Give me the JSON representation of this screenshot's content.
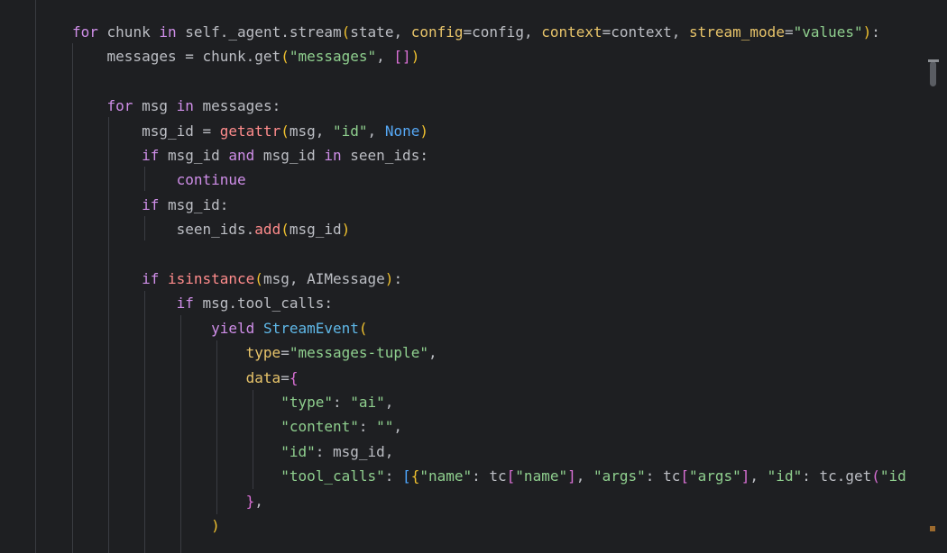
{
  "code_lines": [
    {
      "tokens": [
        {
          "t": "for",
          "c": "kw"
        },
        {
          "t": " chunk "
        },
        {
          "t": "in",
          "c": "kw"
        },
        {
          "t": " self._agent.stream"
        },
        {
          "t": "(",
          "c": "b1"
        },
        {
          "t": "state, "
        },
        {
          "t": "config",
          "c": "pm"
        },
        {
          "t": "=config, "
        },
        {
          "t": "context",
          "c": "pm"
        },
        {
          "t": "=context, "
        },
        {
          "t": "stream_mode",
          "c": "pm"
        },
        {
          "t": "="
        },
        {
          "t": "\"values\"",
          "c": "st"
        },
        {
          "t": ")",
          "c": "b1"
        },
        {
          "t": ":"
        }
      ]
    },
    {
      "tokens": [
        {
          "t": "    messages = chunk.get"
        },
        {
          "t": "(",
          "c": "b1"
        },
        {
          "t": "\"messages\"",
          "c": "st"
        },
        {
          "t": ", "
        },
        {
          "t": "[]",
          "c": "b2"
        },
        {
          "t": ")",
          "c": "b1"
        }
      ]
    },
    {
      "tokens": []
    },
    {
      "tokens": [
        {
          "t": "    "
        },
        {
          "t": "for",
          "c": "kw"
        },
        {
          "t": " msg "
        },
        {
          "t": "in",
          "c": "kw"
        },
        {
          "t": " messages:"
        }
      ]
    },
    {
      "tokens": [
        {
          "t": "        msg_id = "
        },
        {
          "t": "getattr",
          "c": "fn"
        },
        {
          "t": "(",
          "c": "b1"
        },
        {
          "t": "msg, "
        },
        {
          "t": "\"id\"",
          "c": "st"
        },
        {
          "t": ", "
        },
        {
          "t": "None",
          "c": "pr"
        },
        {
          "t": ")",
          "c": "b1"
        }
      ]
    },
    {
      "tokens": [
        {
          "t": "        "
        },
        {
          "t": "if",
          "c": "kw"
        },
        {
          "t": " msg_id "
        },
        {
          "t": "and",
          "c": "kw"
        },
        {
          "t": " msg_id "
        },
        {
          "t": "in",
          "c": "kw"
        },
        {
          "t": " seen_ids:"
        }
      ]
    },
    {
      "tokens": [
        {
          "t": "            "
        },
        {
          "t": "continue",
          "c": "kw"
        }
      ]
    },
    {
      "tokens": [
        {
          "t": "        "
        },
        {
          "t": "if",
          "c": "kw"
        },
        {
          "t": " msg_id:"
        }
      ]
    },
    {
      "tokens": [
        {
          "t": "            seen_ids."
        },
        {
          "t": "add",
          "c": "fn"
        },
        {
          "t": "(",
          "c": "b1"
        },
        {
          "t": "msg_id"
        },
        {
          "t": ")",
          "c": "b1"
        }
      ]
    },
    {
      "tokens": []
    },
    {
      "tokens": [
        {
          "t": "        "
        },
        {
          "t": "if",
          "c": "kw"
        },
        {
          "t": " "
        },
        {
          "t": "isinstance",
          "c": "fn"
        },
        {
          "t": "(",
          "c": "b1"
        },
        {
          "t": "msg, AIMessage"
        },
        {
          "t": ")",
          "c": "b1"
        },
        {
          "t": ":"
        }
      ]
    },
    {
      "tokens": [
        {
          "t": "            "
        },
        {
          "t": "if",
          "c": "kw"
        },
        {
          "t": " msg.tool_calls:"
        }
      ]
    },
    {
      "tokens": [
        {
          "t": "                "
        },
        {
          "t": "yield",
          "c": "kw"
        },
        {
          "t": " "
        },
        {
          "t": "StreamEvent",
          "c": "cl"
        },
        {
          "t": "(",
          "c": "b1"
        }
      ]
    },
    {
      "tokens": [
        {
          "t": "                    "
        },
        {
          "t": "type",
          "c": "pm"
        },
        {
          "t": "="
        },
        {
          "t": "\"messages-tuple\"",
          "c": "st"
        },
        {
          "t": ","
        }
      ]
    },
    {
      "tokens": [
        {
          "t": "                    "
        },
        {
          "t": "data",
          "c": "pm"
        },
        {
          "t": "="
        },
        {
          "t": "{",
          "c": "b2"
        }
      ]
    },
    {
      "tokens": [
        {
          "t": "                        "
        },
        {
          "t": "\"type\"",
          "c": "st"
        },
        {
          "t": ": "
        },
        {
          "t": "\"ai\"",
          "c": "st"
        },
        {
          "t": ","
        }
      ]
    },
    {
      "tokens": [
        {
          "t": "                        "
        },
        {
          "t": "\"content\"",
          "c": "st"
        },
        {
          "t": ": "
        },
        {
          "t": "\"\"",
          "c": "st"
        },
        {
          "t": ","
        }
      ]
    },
    {
      "tokens": [
        {
          "t": "                        "
        },
        {
          "t": "\"id\"",
          "c": "st"
        },
        {
          "t": ": msg_id,"
        }
      ]
    },
    {
      "tokens": [
        {
          "t": "                        "
        },
        {
          "t": "\"tool_calls\"",
          "c": "st"
        },
        {
          "t": ": "
        },
        {
          "t": "[",
          "c": "b3"
        },
        {
          "t": "{",
          "c": "b1"
        },
        {
          "t": "\"name\"",
          "c": "st"
        },
        {
          "t": ": tc"
        },
        {
          "t": "[",
          "c": "b2"
        },
        {
          "t": "\"name\"",
          "c": "st"
        },
        {
          "t": "]",
          "c": "b2"
        },
        {
          "t": ", "
        },
        {
          "t": "\"args\"",
          "c": "st"
        },
        {
          "t": ": tc"
        },
        {
          "t": "[",
          "c": "b2"
        },
        {
          "t": "\"args\"",
          "c": "st"
        },
        {
          "t": "]",
          "c": "b2"
        },
        {
          "t": ", "
        },
        {
          "t": "\"id\"",
          "c": "st"
        },
        {
          "t": ": tc.get"
        },
        {
          "t": "(",
          "c": "b2"
        },
        {
          "t": "\"id",
          "c": "st"
        }
      ]
    },
    {
      "tokens": [
        {
          "t": "                    "
        },
        {
          "t": "}",
          "c": "b2"
        },
        {
          "t": ","
        }
      ]
    },
    {
      "tokens": [
        {
          "t": "                "
        },
        {
          "t": ")",
          "c": "b1"
        }
      ]
    }
  ],
  "colors": {
    "background": "#1e1f22",
    "keyword": "#cf8ee8",
    "string": "#8fcf8e",
    "builtin_fn": "#ff8c8c",
    "constant": "#56a8f5",
    "param": "#e8c46a",
    "class": "#5fb8e8"
  },
  "icons": {
    "scroll_marker_top": "scrollbar-marker-icon",
    "scroll_marker_bottom": "warning-marker-icon"
  }
}
